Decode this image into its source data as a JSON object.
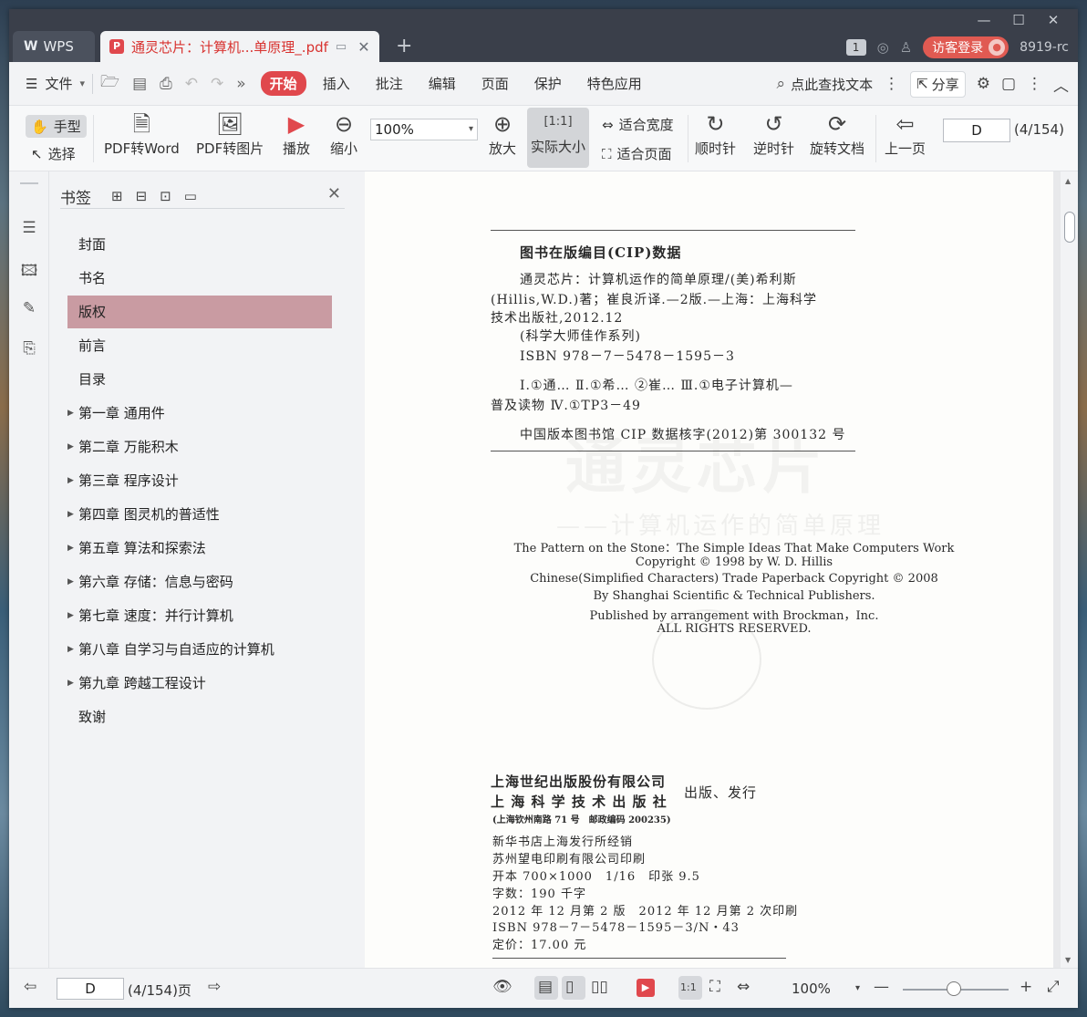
{
  "window": {
    "controls": [
      "—",
      "☐",
      "✕"
    ]
  },
  "tabs": {
    "wps_label": "WPS",
    "doc_title": "通灵芯片：计算机...单原理_.pdf"
  },
  "titlebar_right": {
    "count": "1",
    "guest_login": "访客登录",
    "user_id": "8919-rc"
  },
  "menubar": {
    "file": "文件",
    "tabs": [
      "开始",
      "插入",
      "批注",
      "编辑",
      "页面",
      "保护",
      "特色应用"
    ],
    "active_tab": "开始",
    "find_text": "点此查找文本",
    "share": "分享"
  },
  "ribbon": {
    "hand": "手型",
    "select": "选择",
    "pdf_to_word": "PDF转Word",
    "pdf_to_image": "PDF转图片",
    "play": "播放",
    "zoom_out": "缩小",
    "zoom_value": "100%",
    "zoom_in": "放大",
    "actual_size": "实际大小",
    "fit_width": "适合宽度",
    "fit_page": "适合页面",
    "clockwise": "顺时针",
    "counterclockwise": "逆时针",
    "rotate_doc": "旋转文档",
    "prev_page": "上一页",
    "page_input": "D",
    "page_count": "(4/154)"
  },
  "bookmarks": {
    "title": "书签",
    "items": [
      {
        "label": "封面",
        "expandable": false
      },
      {
        "label": "书名",
        "expandable": false
      },
      {
        "label": "版权",
        "expandable": false,
        "selected": true
      },
      {
        "label": "前言",
        "expandable": false
      },
      {
        "label": "目录",
        "expandable": false
      },
      {
        "label": "第一章  通用件",
        "expandable": true
      },
      {
        "label": "第二章  万能积木",
        "expandable": true
      },
      {
        "label": "第三章  程序设计",
        "expandable": true
      },
      {
        "label": "第四章  图灵机的普适性",
        "expandable": true
      },
      {
        "label": "第五章  算法和探索法",
        "expandable": true
      },
      {
        "label": "第六章  存储：信息与密码",
        "expandable": true
      },
      {
        "label": "第七章  速度：并行计算机",
        "expandable": true
      },
      {
        "label": "第八章  自学习与自适应的计算机",
        "expandable": true
      },
      {
        "label": "第九章  跨越工程设计",
        "expandable": true
      },
      {
        "label": "致谢",
        "expandable": false
      }
    ]
  },
  "page": {
    "cip_title": "图书在版编目(CIP)数据",
    "cip_lines": [
      "通灵芯片：计算机运作的简单原理/(美)希利斯",
      "(Hillis,W.D.)著；崔良沂译.—2版.—上海：上海科学",
      "技术出版社,2012.12",
      "(科学大师佳作系列)",
      "ISBN 978－7－5478－1595－3"
    ],
    "classification_lines": [
      "Ⅰ.①通… Ⅱ.①希… ②崔… Ⅲ.①电子计算机—",
      "普及读物 Ⅳ.①TP3－49"
    ],
    "cip_check": "中国版本图书馆 CIP 数据核字(2012)第 300132 号",
    "english_lines": [
      "The Pattern on the Stone：The Simple Ideas That Make Computers Work",
      "Copyright © 1998 by W. D. Hillis",
      "Chinese(Simplified Characters) Trade Paperback Copyright © 2008",
      "By Shanghai Scientific & Technical Publishers.",
      "Published by arrangement with Brockman，Inc.",
      "ALL RIGHTS RESERVED."
    ],
    "publisher_1": "上海世纪出版股份有限公司",
    "publisher_2": "上 海 科 学 技 术 出 版 社",
    "publish_role": "出版、发行",
    "address": "(上海钦州南路 71 号　邮政编码 200235)",
    "print_lines": [
      "新华书店上海发行所经销",
      "苏州望电印刷有限公司印刷",
      "开本 700×1000　1/16　印张 9.5",
      "字数：190 千字",
      "2012 年 12 月第 2 版　2012 年 12 月第 2 次印刷",
      "ISBN 978－7－5478－1595－3/N・43",
      "定价：17.00 元"
    ]
  },
  "statusbar": {
    "page_input": "D",
    "page_count": "(4/154)页",
    "zoom_value": "100%",
    "zoom_level_percent": 100
  },
  "colors": {
    "accent": "#e0484d",
    "bookmark_selected": "#c99ba2",
    "titlebar": "#3a3f4a"
  }
}
